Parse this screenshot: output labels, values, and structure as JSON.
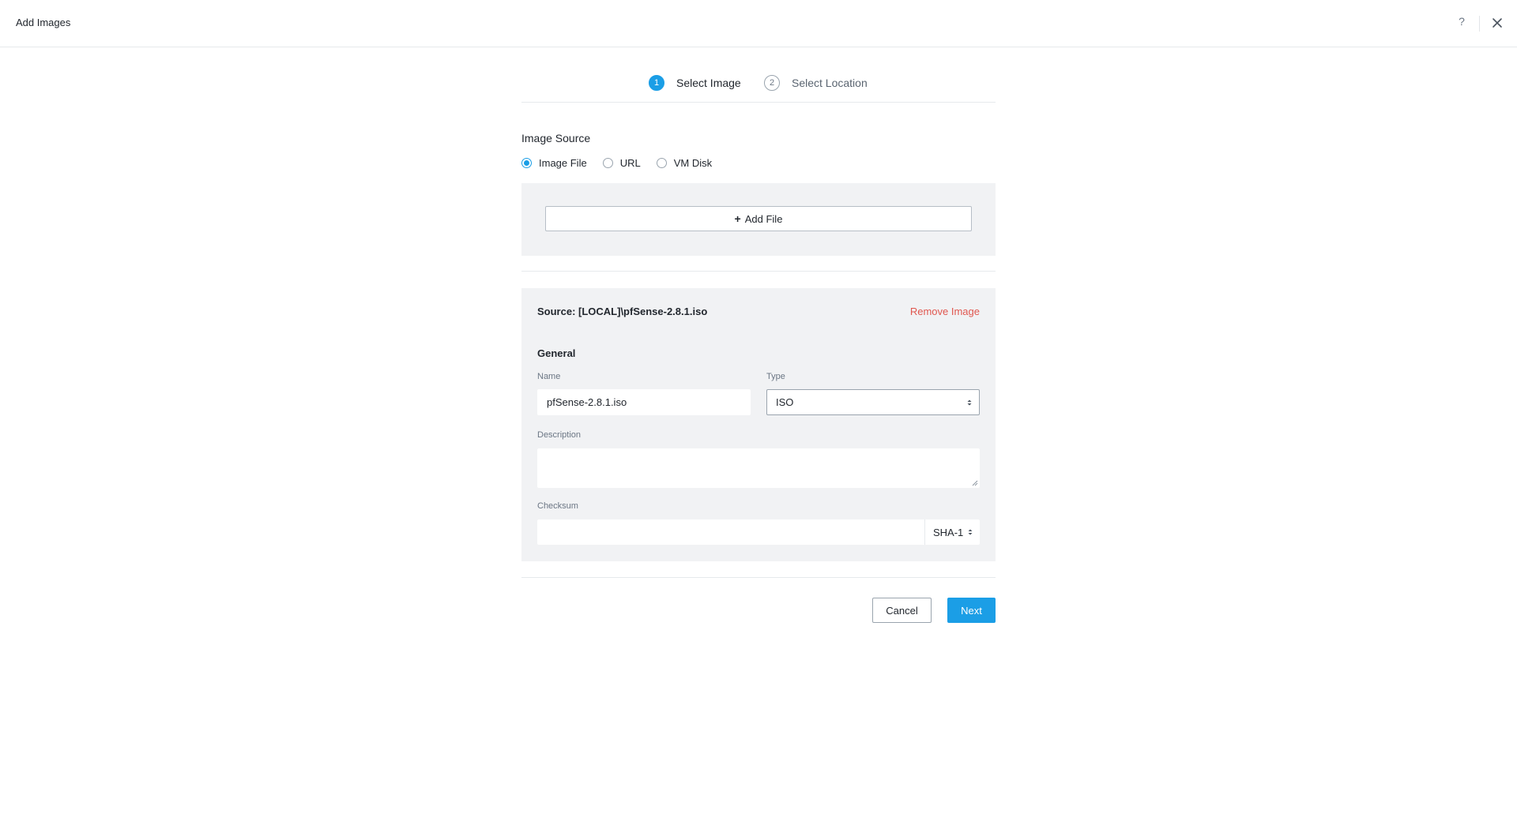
{
  "header": {
    "title": "Add Images",
    "help_icon": "?"
  },
  "wizard": {
    "steps": [
      {
        "number": "1",
        "label": "Select Image",
        "state": "active"
      },
      {
        "number": "2",
        "label": "Select Location",
        "state": "inactive"
      }
    ]
  },
  "image_source": {
    "title": "Image Source",
    "options": [
      {
        "label": "Image File",
        "checked": true
      },
      {
        "label": "URL",
        "checked": false
      },
      {
        "label": "VM Disk",
        "checked": false
      }
    ],
    "add_file_label": "Add File",
    "add_file_icon": "+"
  },
  "image": {
    "source_text": "Source: [LOCAL]\\pfSense-2.8.1.iso",
    "remove_label": "Remove Image",
    "general_title": "General",
    "name_label": "Name",
    "name_value": "pfSense-2.8.1.iso",
    "type_label": "Type",
    "type_value": "ISO",
    "description_label": "Description",
    "description_value": "",
    "checksum_label": "Checksum",
    "checksum_value": "",
    "checksum_algo": "SHA-1"
  },
  "footer": {
    "cancel_label": "Cancel",
    "next_label": "Next"
  },
  "colors": {
    "accent": "#1b9ee6",
    "danger": "#e0574f",
    "panel_bg": "#f1f2f4"
  }
}
